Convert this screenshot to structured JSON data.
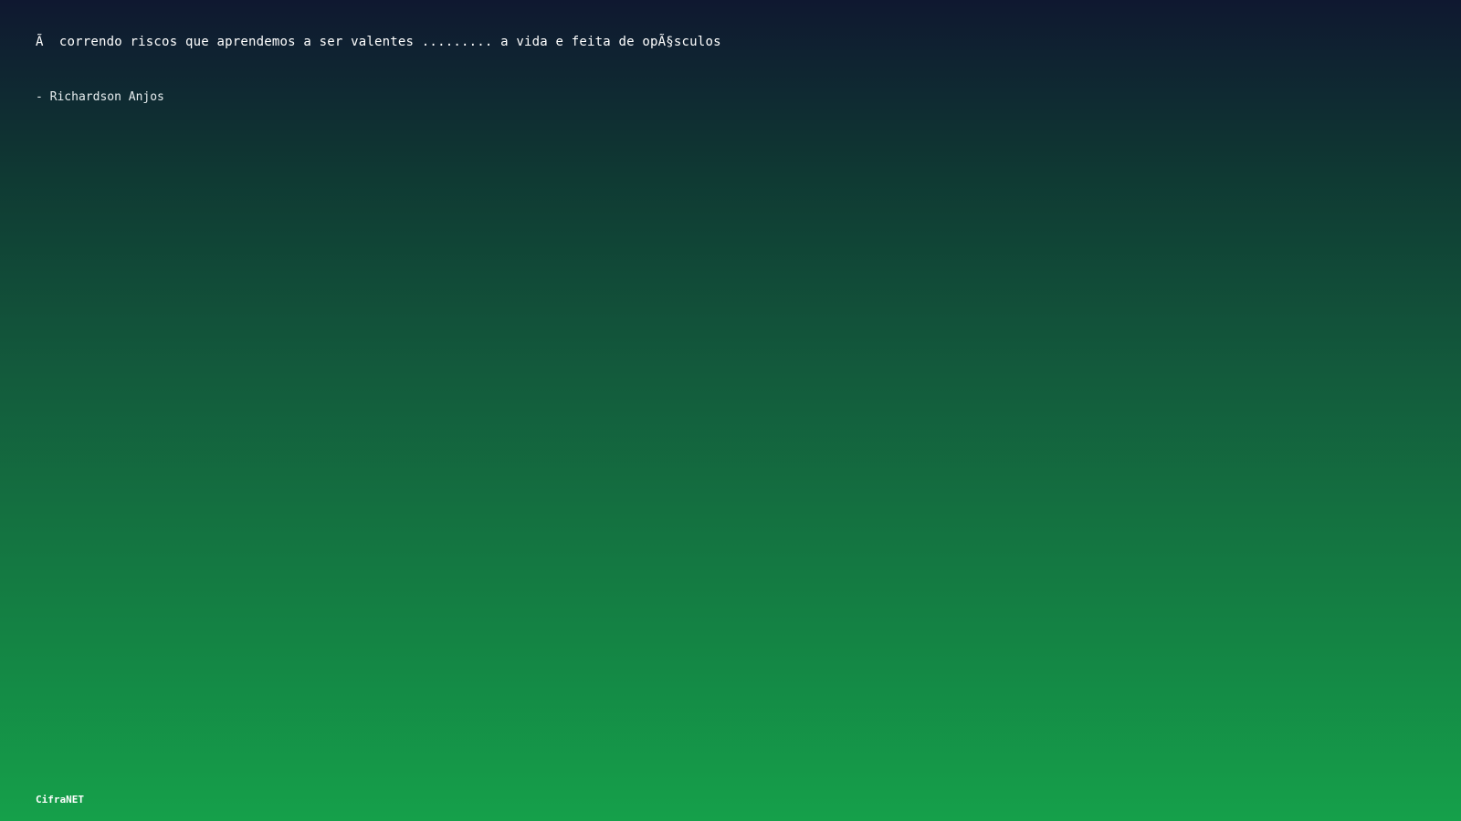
{
  "quote": {
    "text": "Ã  correndo riscos que aprendemos a ser valentes ......... a vida e feita de opÃ§sculos"
  },
  "author": {
    "text": "- Richardson Anjos"
  },
  "footer": {
    "brand": "CifraNET"
  }
}
